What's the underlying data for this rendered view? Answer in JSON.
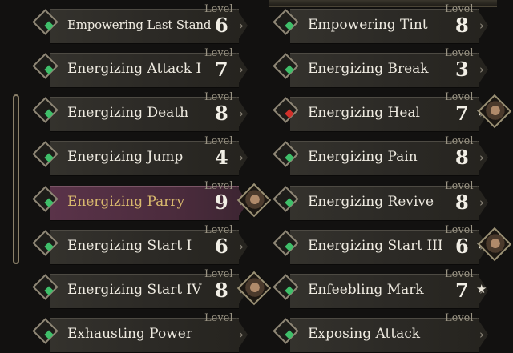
{
  "cards": [
    {
      "name": "Empowering Last Stand",
      "level_label": "Level",
      "level": "6",
      "icon": "green-rune-icon",
      "icon_color": "#3fbf6a",
      "small": true
    },
    {
      "name": "Empowering Tint",
      "level_label": "Level",
      "level": "8",
      "icon": "green-rune-icon",
      "icon_color": "#3fbf6a"
    },
    {
      "name": "Energizing Attack I",
      "level_label": "Level",
      "level": "7",
      "icon": "green-rune-icon",
      "icon_color": "#3fbf6a"
    },
    {
      "name": "Energizing Break",
      "level_label": "Level",
      "level": "3",
      "icon": "green-rune-icon",
      "icon_color": "#3fbf6a"
    },
    {
      "name": "Energizing Death",
      "level_label": "Level",
      "level": "8",
      "icon": "green-rune-icon",
      "icon_color": "#3fbf6a"
    },
    {
      "name": "Energizing Heal",
      "level_label": "Level",
      "level": "7",
      "icon": "red-rune-icon",
      "icon_color": "#d0302a",
      "star": "★",
      "portrait": true
    },
    {
      "name": "Energizing Jump",
      "level_label": "Level",
      "level": "4",
      "icon": "green-rune-icon",
      "icon_color": "#3fbf6a"
    },
    {
      "name": "Energizing Pain",
      "level_label": "Level",
      "level": "8",
      "icon": "green-rune-icon",
      "icon_color": "#3fbf6a"
    },
    {
      "name": "Energizing Parry",
      "level_label": "Level",
      "level": "9",
      "icon": "green-rune-icon",
      "icon_color": "#3fbf6a",
      "highlight": true,
      "portrait": true
    },
    {
      "name": "Energizing Revive",
      "level_label": "Level",
      "level": "8",
      "icon": "green-rune-icon",
      "icon_color": "#3fbf6a"
    },
    {
      "name": "Energizing Start I",
      "level_label": "Level",
      "level": "6",
      "icon": "green-rune-icon",
      "icon_color": "#3fbf6a"
    },
    {
      "name": "Energizing Start III",
      "level_label": "Level",
      "level": "6",
      "icon": "green-rune-icon",
      "icon_color": "#3fbf6a",
      "star": "★",
      "portrait": true
    },
    {
      "name": "Energizing Start IV",
      "level_label": "Level",
      "level": "8",
      "icon": "green-rune-icon",
      "icon_color": "#3fbf6a",
      "portrait": true
    },
    {
      "name": "Enfeebling Mark",
      "level_label": "Level",
      "level": "7",
      "icon": "green-rune-icon",
      "icon_color": "#3fbf6a",
      "star": "★"
    },
    {
      "name": "Exhausting Power",
      "level_label": "Level",
      "level": "",
      "icon": "green-rune-icon",
      "icon_color": "#3fbf6a"
    },
    {
      "name": "Exposing Attack",
      "level_label": "Level",
      "level": "",
      "icon": "green-rune-icon",
      "icon_color": "#3fbf6a"
    }
  ]
}
